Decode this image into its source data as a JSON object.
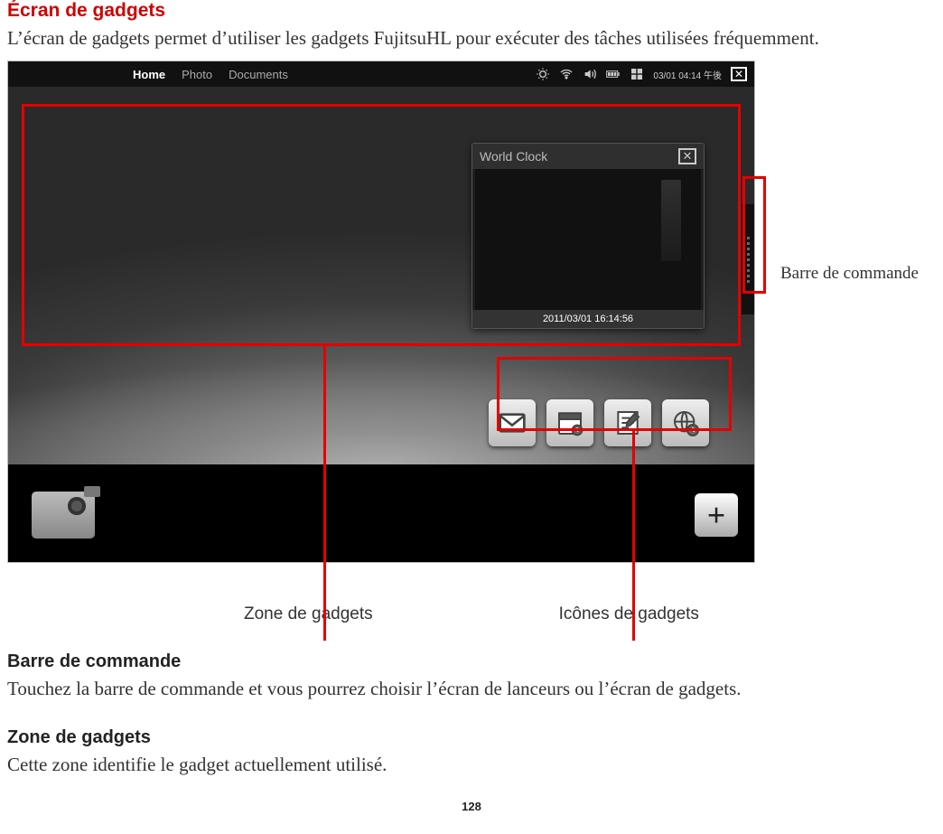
{
  "title": "Écran de gadgets",
  "intro": "L’écran de gadgets permet d’utiliser les gadgets FujitsuHL pour exécuter des tâches utilisées fréquemment.",
  "screenshot": {
    "tabs": {
      "home": "Home",
      "photo": "Photo",
      "documents": "Documents"
    },
    "status_clock": "03/01 04:14 午後",
    "world_clock": {
      "title": "World Clock",
      "timestamp": "2011/03/01 16:14:56"
    },
    "plus": "+"
  },
  "callouts": {
    "command_bar": "Barre de commande",
    "zone": "Zone de gadgets",
    "icons": "Icônes de gadgets"
  },
  "sections": {
    "cmd_h": "Barre de commande",
    "cmd_p": "Touchez la barre de commande et vous pourrez choisir l’écran de lanceurs ou l’écran de gadgets.",
    "zone_h": "Zone de gadgets",
    "zone_p": "Cette zone identifie le gadget actuellement utilisé."
  },
  "page_number": "128"
}
